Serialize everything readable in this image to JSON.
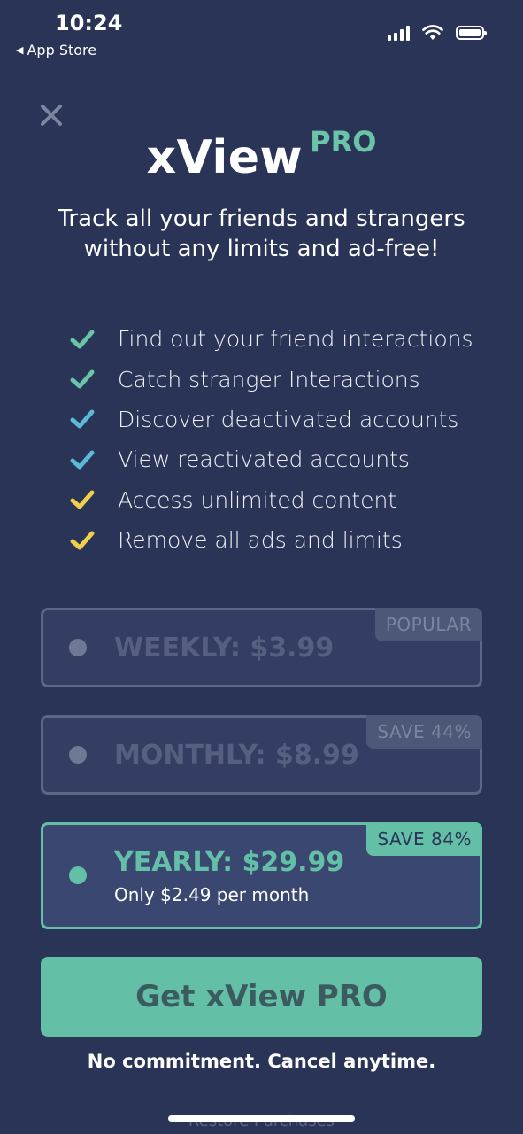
{
  "status_bar": {
    "time": "10:24",
    "back_label": "App Store"
  },
  "header": {
    "title": "xView",
    "title_badge": "PRO",
    "subtitle_line1": "Track all your friends and strangers",
    "subtitle_line2": "without any limits and ad-free!"
  },
  "features": [
    {
      "text": "Find out your friend interactions",
      "color": "#6ac4a8"
    },
    {
      "text": "Catch stranger Interactions",
      "color": "#6ac4a8"
    },
    {
      "text": "Discover deactivated accounts",
      "color": "#5bbad6"
    },
    {
      "text": "View reactivated accounts",
      "color": "#5bbad6"
    },
    {
      "text": "Access unlimited content",
      "color": "#f1cf4b"
    },
    {
      "text": "Remove all ads and limits",
      "color": "#f1cf4b"
    }
  ],
  "plans": [
    {
      "label": "WEEKLY: $3.99",
      "badge": "POPULAR",
      "selected": false
    },
    {
      "label": "MONTHLY: $8.99",
      "badge": "SAVE 44%",
      "selected": false
    },
    {
      "label": "YEARLY: $29.99",
      "sublabel": "Only $2.49 per month",
      "badge": "SAVE 84%",
      "selected": true
    }
  ],
  "cta": {
    "label": "Get xView PRO",
    "note": "No commitment. Cancel anytime."
  },
  "footer": {
    "restore_label": "Restore Purchases"
  },
  "colors": {
    "background": "#2a3457",
    "accent": "#63c0a6",
    "check_green": "#6ac4a8",
    "check_blue": "#5bbad6",
    "check_yellow": "#f1cf4b"
  }
}
